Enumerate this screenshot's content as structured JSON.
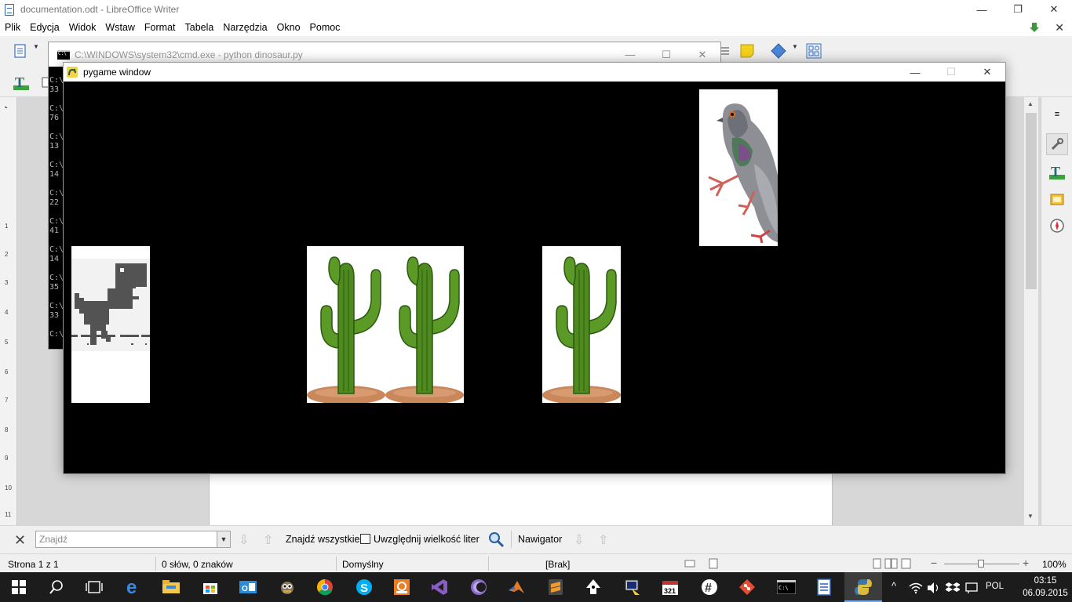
{
  "writer": {
    "title": "documentation.odt - LibreOffice Writer",
    "menu": [
      "Plik",
      "Edycja",
      "Widok",
      "Wstaw",
      "Format",
      "Tabela",
      "Narzędzia",
      "Okno",
      "Pomoc"
    ],
    "ruler_ticks": [
      "1",
      "2",
      "3",
      "4",
      "5",
      "6",
      "7",
      "8",
      "9",
      "10",
      "11"
    ],
    "find_bar": {
      "placeholder": "Znajdź",
      "find_all": "Znajdź wszystkie",
      "match_case": "Uwzględnij wielkość liter",
      "navigator": "Nawigator"
    },
    "status": {
      "page": "Strona 1 z 1",
      "words": "0 słów, 0 znaków",
      "style": "Domyślny",
      "language": "[Brak]",
      "zoom": "100%"
    }
  },
  "cmd": {
    "title": "C:\\WINDOWS\\system32\\cmd.exe - python  dinosaur.py",
    "lines": [
      "C:\\",
      "33",
      "",
      "C:\\",
      "76",
      "",
      "C:\\",
      "13",
      "",
      "C:\\",
      "14",
      "",
      "C:\\",
      "22",
      "",
      "C:\\",
      "41",
      "",
      "C:\\",
      "14",
      "",
      "C:\\",
      "35",
      "",
      "C:\\",
      "33",
      "",
      "C:\\"
    ]
  },
  "pygame": {
    "title": "pygame window",
    "sprites": [
      "dinosaur",
      "cactus",
      "cactus",
      "cactus",
      "pigeon"
    ]
  },
  "taskbar": {
    "language": "POL",
    "time": "03:15",
    "date": "06.09.2015",
    "apps": [
      "start",
      "search",
      "task-view",
      "edge",
      "file-explorer",
      "store",
      "outlook",
      "gimp",
      "chrome",
      "skype",
      "pdf",
      "visual-studio",
      "eclipse",
      "matlab",
      "sublime",
      "inkscape",
      "putty",
      "pix",
      "git",
      "git-scm",
      "cmd",
      "writer",
      "python"
    ]
  },
  "colors": {
    "taskbar": "#1c1c1c",
    "canvas": "#000000",
    "cactus": "#4f8a1f",
    "sand": "#c9875a",
    "dino": "#535353"
  }
}
